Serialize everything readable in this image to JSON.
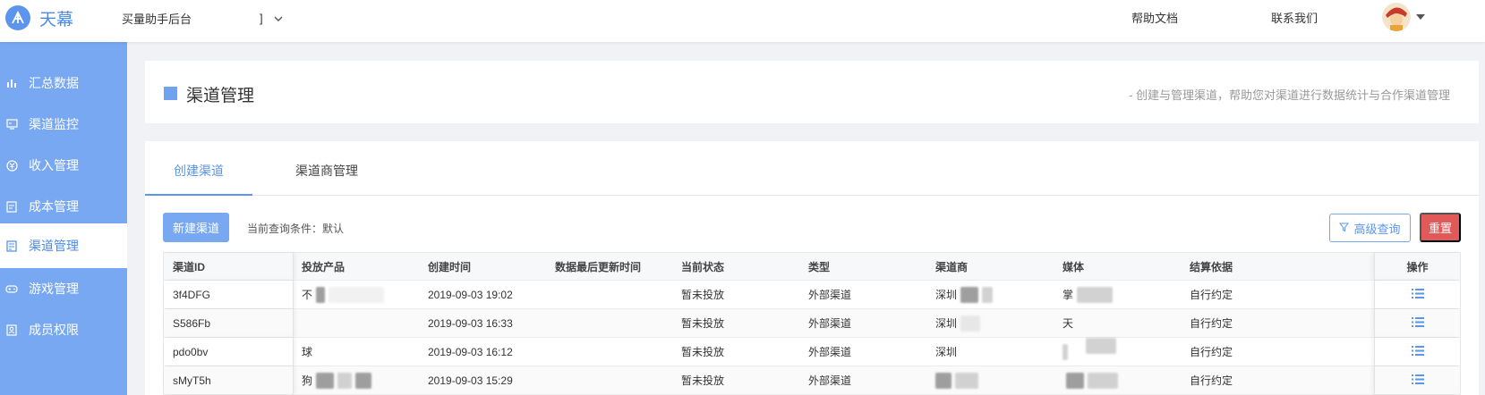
{
  "brand": {
    "name": "天幕"
  },
  "app_select": {
    "label": "买量助手后台",
    "suffix": "]"
  },
  "topnav": {
    "help": "帮助文档",
    "contact": "联系我们"
  },
  "sidebar": {
    "items": [
      {
        "label": "汇总数据",
        "icon": "bar-chart-icon"
      },
      {
        "label": "渠道监控",
        "icon": "monitor-icon"
      },
      {
        "label": "收入管理",
        "icon": "yen-circle-icon"
      },
      {
        "label": "成本管理",
        "icon": "document-icon"
      },
      {
        "label": "渠道管理",
        "icon": "channel-icon",
        "active": true
      },
      {
        "label": "游戏管理",
        "icon": "gamepad-icon"
      },
      {
        "label": "成员权限",
        "icon": "member-icon"
      }
    ]
  },
  "header": {
    "title": "渠道管理",
    "subtitle": "- 创建与管理渠道，帮助您对渠道进行数据统计与合作渠道管理"
  },
  "tabs": [
    {
      "label": "创建渠道",
      "active": true
    },
    {
      "label": "渠道商管理",
      "active": false
    }
  ],
  "toolbar": {
    "new_button": "新建渠道",
    "condition_label": "当前查询条件：默认",
    "advanced_button": "高级查询",
    "reset_button": "重置"
  },
  "table": {
    "columns": [
      "渠道ID",
      "投放产品",
      "创建时间",
      "数据最后更新时间",
      "当前状态",
      "类型",
      "渠道商",
      "媒体",
      "结算依据",
      "操作"
    ],
    "rows": [
      {
        "id": "3f4DFG",
        "product": "不",
        "created": "2019-09-03 19:02",
        "updated": "",
        "status": "暂未投放",
        "type": "外部渠道",
        "vendor": "深圳",
        "media": "掌",
        "settle": "自行约定"
      },
      {
        "id": "S586Fb",
        "product": "",
        "created": "2019-09-03 16:33",
        "updated": "",
        "status": "暂未投放",
        "type": "外部渠道",
        "vendor": "深圳",
        "media": "天",
        "settle": "自行约定"
      },
      {
        "id": "pdo0bv",
        "product": "球",
        "created": "2019-09-03 16:12",
        "updated": "",
        "status": "暂未投放",
        "type": "外部渠道",
        "vendor": "深圳",
        "media": "",
        "settle": "自行约定"
      },
      {
        "id": "sMyT5h",
        "product": "狗",
        "created": "2019-09-03 15:29",
        "updated": "",
        "status": "暂未投放",
        "type": "外部渠道",
        "vendor": "",
        "media": "",
        "settle": "自行约定"
      }
    ]
  },
  "colors": {
    "accent": "#5b95ee",
    "sidebar": "#79a8f2",
    "danger": "#e05a5a"
  }
}
